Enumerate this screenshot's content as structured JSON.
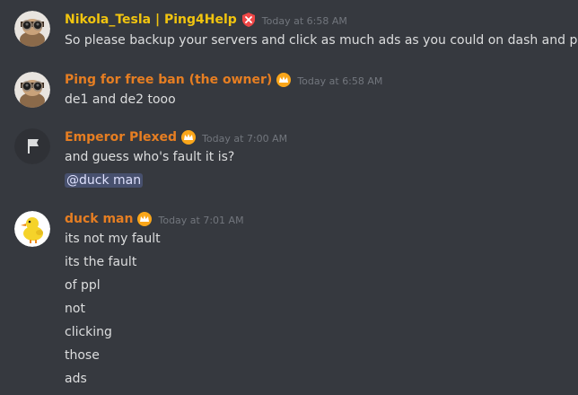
{
  "colors": {
    "background": "#36393f",
    "text": "#dcddde",
    "timestamp": "#72767d",
    "role_yellow": "#f1c40f",
    "role_orange": "#e67e22"
  },
  "messages": [
    {
      "username": "Nikola_Tesla | Ping4Help",
      "name_color": "#f1c40f",
      "badge_icon": "shield-tools-badge-icon",
      "avatar_icon": "goggles-avatar-icon",
      "timestamp": "Today at 6:58 AM",
      "lines": [
        "So please backup your servers and click as much ads as you could on dash and panel"
      ]
    },
    {
      "username": "Ping for free ban (the owner)",
      "name_color": "#e67e22",
      "badge_icon": "crown-badge-icon",
      "avatar_icon": "goggles-avatar-icon",
      "timestamp": "Today at 6:58 AM",
      "lines": [
        "de1 and de2 tooo"
      ]
    },
    {
      "username": "Emperor Plexed",
      "name_color": "#e67e22",
      "badge_icon": "crown-badge-icon",
      "avatar_icon": "flag-avatar-icon",
      "timestamp": "Today at 7:00 AM",
      "lines": [
        "and guess who's fault it is?"
      ],
      "mention": "@duck man"
    },
    {
      "username": "duck man",
      "name_color": "#e67e22",
      "badge_icon": "crown-badge-icon",
      "avatar_icon": "duck-avatar-icon",
      "timestamp": "Today at 7:01 AM",
      "lines": [
        "its not my fault",
        "its the fault",
        "of ppl",
        "not",
        "clicking",
        "those",
        "ads"
      ]
    }
  ]
}
